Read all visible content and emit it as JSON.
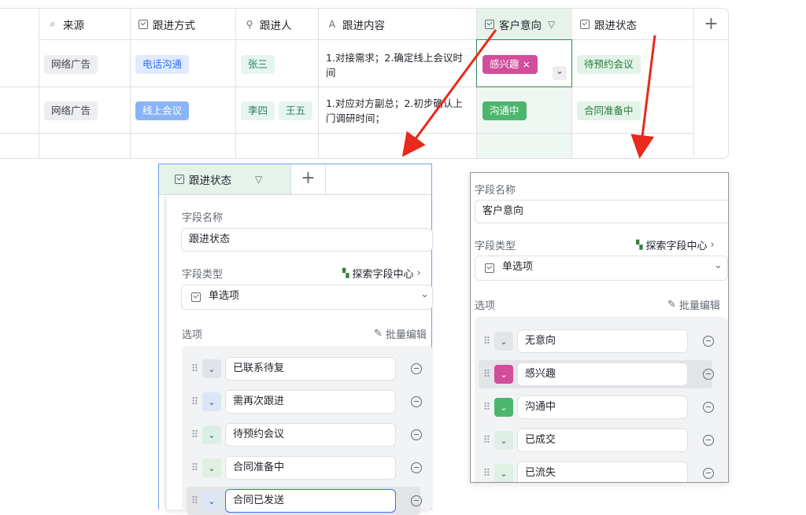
{
  "table": {
    "headers": [
      {
        "icon": "search-doc-icon",
        "label": "来源"
      },
      {
        "icon": "checkbox-icon",
        "label": "跟进方式"
      },
      {
        "icon": "link-icon",
        "label": "跟进人"
      },
      {
        "icon": "text-icon",
        "label": "跟进内容"
      },
      {
        "icon": "checkbox-icon",
        "label": "客户意向"
      },
      {
        "icon": "checkbox-icon",
        "label": "跟进状态"
      }
    ],
    "add_symbol": "+",
    "filter_symbol": "▽",
    "rows": [
      {
        "source": "网络广告",
        "method": "电话沟通",
        "people": [
          "张三"
        ],
        "content": "1.对接需求；2.确定线上会议时间",
        "intent": "感兴趣",
        "intent_remove": "×",
        "status": "待预约会议"
      },
      {
        "source": "网络广告",
        "method": "线上会议",
        "people": [
          "李四",
          "王五"
        ],
        "content": "1.对应对方副总；2.初步确认上门调研时间；",
        "intent": "沟通中",
        "status": "合同准备中"
      }
    ],
    "chevron": "⌄"
  },
  "left_panel": {
    "header_label": "跟进状态",
    "filter_symbol": "▽",
    "add_symbol": "+",
    "field_name_label": "字段名称",
    "field_name_value": "跟进状态",
    "field_type_label": "字段类型",
    "explore_label": "探索字段中心",
    "type_value": "单选项",
    "options_label": "选项",
    "batch_edit_label": "批量编辑",
    "options": [
      "已联系待复",
      "需再次跟进",
      "待预约会议",
      "合同准备中",
      "合同已发送"
    ],
    "option_colors": [
      "#dfe3ea",
      "#dde6f7",
      "#dcefe6",
      "#e0f0e0",
      "#dde6f7"
    ]
  },
  "right_panel": {
    "field_name_label": "字段名称",
    "field_name_value": "客户意向",
    "field_type_label": "字段类型",
    "explore_label": "探索字段中心",
    "type_value": "单选项",
    "options_label": "选项",
    "batch_edit_label": "批量编辑",
    "options": [
      "无意向",
      "感兴趣",
      "沟通中",
      "已成交",
      "已流失"
    ],
    "option_colors": [
      "#e3e5ea",
      "#d24d9b",
      "#4db66e",
      "#e0eee8",
      "#dff0e4"
    ]
  },
  "colors": {
    "accent": "#3370ff",
    "arrow": "#e8291b"
  }
}
